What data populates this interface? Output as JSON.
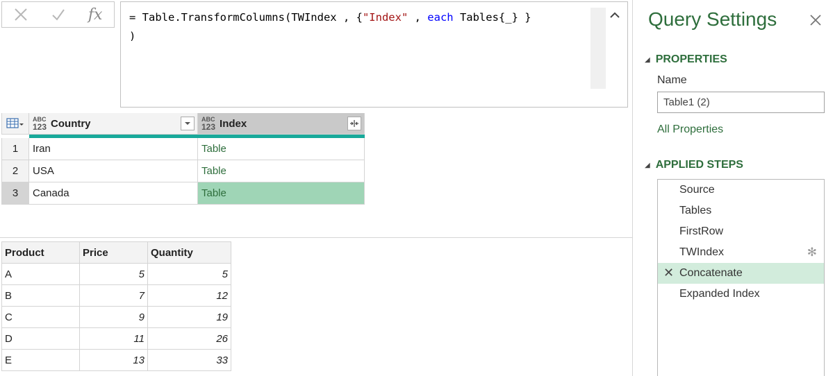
{
  "formula_bar": {
    "cancel_icon": "x-icon",
    "confirm_icon": "check-icon",
    "fx_label": "fx",
    "formula_parts": {
      "p1": "= Table.TransformColumns(TWIndex , {",
      "p2": "\"Index\"",
      "p3": " , ",
      "p4": "each",
      "p5": " Tables{_} }\n)"
    }
  },
  "grid": {
    "columns": [
      {
        "name": "Country",
        "type_top": "ABC",
        "type_bottom": "123"
      },
      {
        "name": "Index",
        "type_top": "ABC",
        "type_bottom": "123"
      }
    ],
    "rows": [
      {
        "n": "1",
        "country": "Iran",
        "index": "Table"
      },
      {
        "n": "2",
        "country": "USA",
        "index": "Table"
      },
      {
        "n": "3",
        "country": "Canada",
        "index": "Table"
      }
    ],
    "selected_row": 3
  },
  "preview": {
    "headers": [
      "Product",
      "Price",
      "Quantity"
    ],
    "rows": [
      [
        "A",
        "5",
        "5"
      ],
      [
        "B",
        "7",
        "12"
      ],
      [
        "C",
        "9",
        "19"
      ],
      [
        "D",
        "11",
        "26"
      ],
      [
        "E",
        "13",
        "33"
      ]
    ]
  },
  "query_settings": {
    "title": "Query Settings",
    "properties_header": "PROPERTIES",
    "name_label": "Name",
    "name_value": "Table1 (2)",
    "all_properties": "All Properties",
    "steps_header": "APPLIED STEPS",
    "steps": [
      "Source",
      "Tables",
      "FirstRow",
      "TWIndex",
      "Concatenate",
      "Expanded Index"
    ],
    "active_step": "Concatenate"
  },
  "colors": {
    "accent_green": "#2e6e3c",
    "teal_bar": "#18a99a",
    "selected_cell": "#9fd5b6",
    "active_step_bg": "#d2ecdc"
  }
}
